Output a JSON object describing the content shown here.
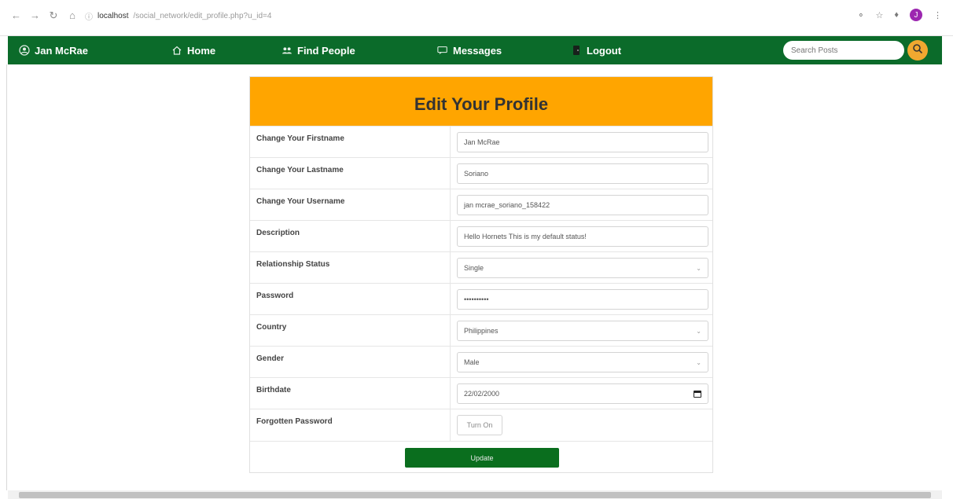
{
  "browser": {
    "back_icon": "arrow-left",
    "forward_icon": "arrow-right",
    "reload_icon": "reload",
    "home_icon": "home",
    "url_host": "localhost",
    "url_path": "/social_network/edit_profile.php?u_id=4",
    "profile_initial": "J"
  },
  "navbar": {
    "user_name": "Jan McRae",
    "home": "Home",
    "find_people": "Find People",
    "messages": "Messages",
    "logout": "Logout",
    "search_placeholder": "Search Posts",
    "brand_color": "#0b6b2a",
    "accent_color": "#f0a830"
  },
  "form": {
    "title": "Edit Your Profile",
    "header_color": "#ffa500",
    "fields": [
      {
        "label": "Change Your Firstname",
        "value": "Jan McRae",
        "type": "text"
      },
      {
        "label": "Change Your Lastname",
        "value": "Soriano",
        "type": "text"
      },
      {
        "label": "Change Your Username",
        "value": "jan mcrae_soriano_158422",
        "type": "text"
      },
      {
        "label": "Description",
        "value": "Hello Hornets This is my default status!",
        "type": "text"
      },
      {
        "label": "Relationship Status",
        "value": "Single",
        "type": "select"
      },
      {
        "label": "Password",
        "value": "••••••••••",
        "type": "password"
      },
      {
        "label": "Country",
        "value": "Philippines",
        "type": "select"
      },
      {
        "label": "Gender",
        "value": "Male",
        "type": "select"
      },
      {
        "label": "Birthdate",
        "value": "22/02/2000",
        "type": "date"
      },
      {
        "label": "Forgotten Password",
        "value": "Turn On",
        "type": "button"
      }
    ],
    "update_label": "Update",
    "update_color": "#0a6e1e"
  }
}
